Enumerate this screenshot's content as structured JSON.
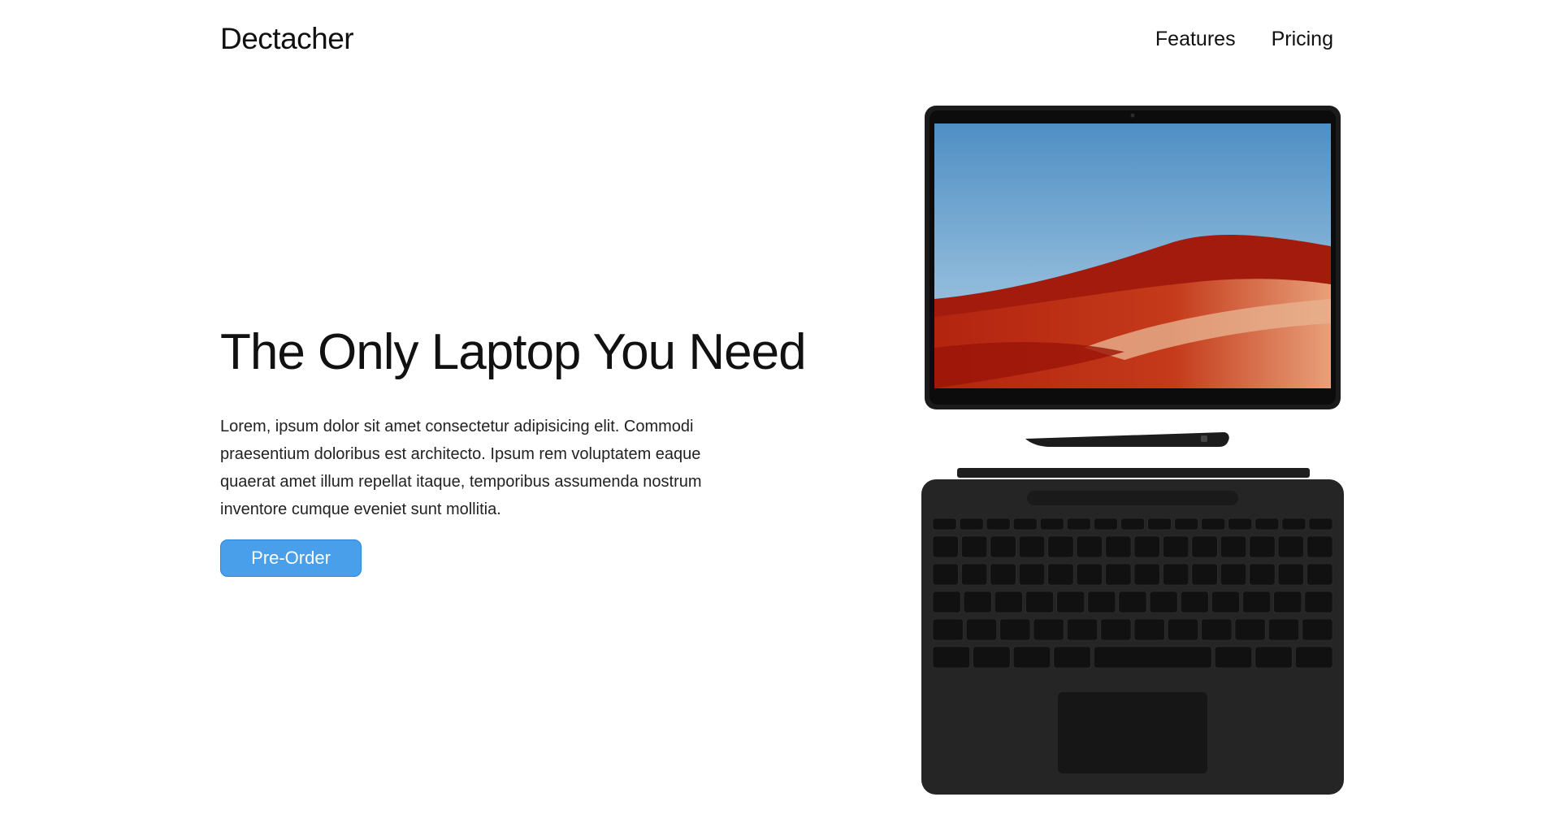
{
  "brand": {
    "name": "Dectacher"
  },
  "nav": {
    "items": [
      {
        "label": "Features"
      },
      {
        "label": "Pricing"
      }
    ]
  },
  "hero": {
    "title": "The Only Laptop You Need",
    "body": "Lorem, ipsum dolor sit amet consectetur adipisicing elit. Commodi praesentium doloribus est architecto. Ipsum rem voluptatem eaque quaerat amet illum repellat itaque, temporibus assumenda nostrum inventore cumque eveniet sunt mollitia.",
    "cta_label": "Pre-Order"
  },
  "product_image": {
    "icon": "laptop-tablet-keyboard-illustration"
  },
  "colors": {
    "accent": "#4a9fea",
    "text": "#111111",
    "background": "#ffffff"
  }
}
